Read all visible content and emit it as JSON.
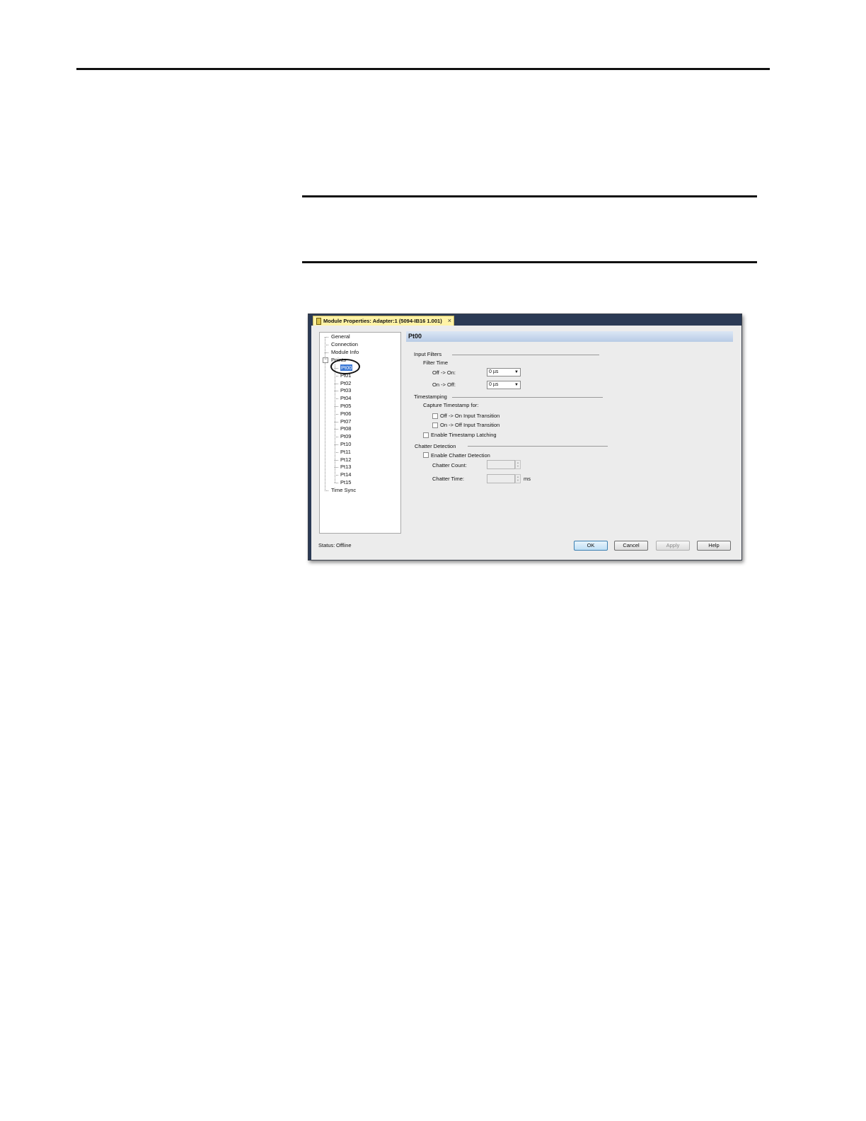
{
  "dialog": {
    "title": "Module Properties: Adapter:1 (5094-IB16 1.001)",
    "close_glyph": "×",
    "tree": {
      "items": [
        "General",
        "Connection",
        "Module Info",
        "Points",
        "Time Sync"
      ],
      "points_children": [
        "Pt00",
        "Pt01",
        "Pt02",
        "Pt03",
        "Pt04",
        "Pt05",
        "Pt06",
        "Pt07",
        "Pt08",
        "Pt09",
        "Pt10",
        "Pt11",
        "Pt12",
        "Pt13",
        "Pt14",
        "Pt15"
      ],
      "selected": "Pt00",
      "expander_glyph": "−"
    },
    "pane": {
      "header": "Pt00",
      "input_filters": {
        "group": "Input Filters",
        "filter_time": "Filter Time",
        "off_on_label": "Off -> On:",
        "off_on_value": "0 µs",
        "on_off_label": "On -> Off:",
        "on_off_value": "0 µs"
      },
      "timestamping": {
        "group": "Timestamping",
        "capture_for": "Capture Timestamp for:",
        "off_on_transition": "Off -> On Input Transition",
        "on_off_transition": "On -> Off Input Transition",
        "enable_latching": "Enable Timestamp Latching"
      },
      "chatter": {
        "group": "Chatter Detection",
        "enable": "Enable Chatter Detection",
        "count_label": "Chatter Count:",
        "time_label": "Chatter Time:",
        "time_unit": "ms"
      }
    },
    "footer": {
      "status_label": "Status:",
      "status_value": "Offline",
      "ok": "OK",
      "cancel": "Cancel",
      "apply": "Apply",
      "help": "Help"
    }
  }
}
